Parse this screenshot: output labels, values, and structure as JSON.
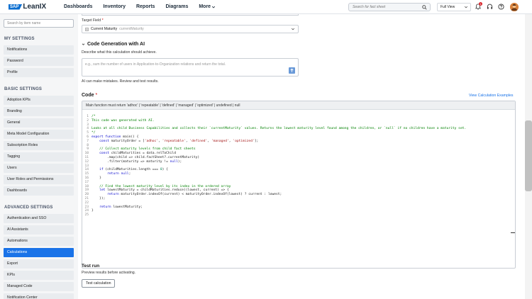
{
  "topbar": {
    "logo_sap": "SAP",
    "logo_name": "LeanIX",
    "nav": [
      "Dashboards",
      "Inventory",
      "Reports",
      "Diagrams",
      "More"
    ],
    "search_placeholder": "Search for fact sheet",
    "view_label": "Full View",
    "notification_count": "1",
    "icons": [
      "search-icon",
      "chevron-down-icon",
      "bell-icon",
      "headset-icon",
      "help-icon",
      "avatar"
    ]
  },
  "sidebar": {
    "search_placeholder": "Search by item name",
    "sections": [
      {
        "title": "MY SETTINGS",
        "items": [
          "Notifications",
          "Password",
          "Profile"
        ]
      },
      {
        "title": "BASIC SETTINGS",
        "items": [
          "Adoption KPIs",
          "Branding",
          "General",
          "Meta Model Configuration",
          "Subscription Roles",
          "Tagging",
          "Users",
          "User Roles and Permissions",
          "Dashboards"
        ]
      },
      {
        "title": "ADVANCED SETTINGS",
        "items": [
          "Authentication and SSO",
          "AI Assistants",
          "Automations",
          "Calculations",
          "Export",
          "KPIs",
          "Managed Code",
          "Notification Center"
        ]
      }
    ],
    "active_item": "Calculations"
  },
  "main": {
    "target_field_label": "Target Field",
    "target_field_required": "*",
    "target_field_value": "Current Maturity",
    "target_field_key": "currentMaturity",
    "codegen_title": "Code Generation with AI",
    "codegen_desc": "Describe what this calculation should achieve.",
    "codegen_placeholder": "e.g., sum the number of users in Application-to-Organization relations and return the total.",
    "ai_warning": "AI can make mistakes. Review and test results.",
    "code_label": "Code",
    "code_required": "*",
    "view_examples": "View Calculation Examples",
    "code_header": "Main function must return 'adhoc' | 'repeatable' | 'defined' | 'managed' | 'optimized' | undefined | null",
    "code_lines": [
      {
        "n": "1",
        "parts": [
          {
            "t": "/*",
            "c": "c-com"
          }
        ]
      },
      {
        "n": "2",
        "parts": [
          {
            "t": "This code was generated with AI.",
            "c": "c-com"
          }
        ]
      },
      {
        "n": "3",
        "parts": []
      },
      {
        "n": "4",
        "parts": [
          {
            "t": "Looks at all child Business Capabilities and collects their `currentMaturity` values. Returns the lowest maturity level found among the children, or `null` if no children have a maturity set.",
            "c": "c-com"
          }
        ]
      },
      {
        "n": "5",
        "parts": [
          {
            "t": "*/",
            "c": "c-com"
          }
        ]
      },
      {
        "n": "6",
        "parts": [
          {
            "t": "export function ",
            "c": "c-kw"
          },
          {
            "t": "main() {",
            "c": "c-txt"
          }
        ]
      },
      {
        "n": "7",
        "parts": [
          {
            "t": "    ",
            "c": "c-txt"
          },
          {
            "t": "const ",
            "c": "c-kw"
          },
          {
            "t": "maturityOrder = [",
            "c": "c-txt"
          },
          {
            "t": "'adhoc'",
            "c": "c-str"
          },
          {
            "t": ", ",
            "c": "c-txt"
          },
          {
            "t": "'repeatable'",
            "c": "c-str"
          },
          {
            "t": ", ",
            "c": "c-txt"
          },
          {
            "t": "'defined'",
            "c": "c-str"
          },
          {
            "t": ", ",
            "c": "c-txt"
          },
          {
            "t": "'managed'",
            "c": "c-str"
          },
          {
            "t": ", ",
            "c": "c-txt"
          },
          {
            "t": "'optimized'",
            "c": "c-str"
          },
          {
            "t": "];",
            "c": "c-txt"
          }
        ]
      },
      {
        "n": "8",
        "parts": []
      },
      {
        "n": "9",
        "parts": [
          {
            "t": "    // Collect maturity levels from child fact sheets",
            "c": "c-com"
          }
        ]
      },
      {
        "n": "10",
        "parts": [
          {
            "t": "    ",
            "c": "c-txt"
          },
          {
            "t": "const ",
            "c": "c-kw"
          },
          {
            "t": "childMaturities = data.relToChild",
            "c": "c-txt"
          }
        ]
      },
      {
        "n": "11",
        "parts": [
          {
            "t": "        .map(child => child.factSheet?.currentMaturity)",
            "c": "c-txt"
          }
        ]
      },
      {
        "n": "12",
        "parts": [
          {
            "t": "        .filter(maturity => maturity != ",
            "c": "c-txt"
          },
          {
            "t": "null",
            "c": "c-kw"
          },
          {
            "t": ");",
            "c": "c-txt"
          }
        ]
      },
      {
        "n": "13",
        "parts": []
      },
      {
        "n": "14",
        "parts": [
          {
            "t": "    ",
            "c": "c-txt"
          },
          {
            "t": "if ",
            "c": "c-kw"
          },
          {
            "t": "(childMaturities.length === ",
            "c": "c-txt"
          },
          {
            "t": "0",
            "c": "c-num"
          },
          {
            "t": ") {",
            "c": "c-txt"
          }
        ]
      },
      {
        "n": "15",
        "parts": [
          {
            "t": "        ",
            "c": "c-txt"
          },
          {
            "t": "return null",
            "c": "c-kw"
          },
          {
            "t": ";",
            "c": "c-txt"
          }
        ]
      },
      {
        "n": "16",
        "parts": [
          {
            "t": "    }",
            "c": "c-txt"
          }
        ]
      },
      {
        "n": "17",
        "parts": []
      },
      {
        "n": "18",
        "parts": [
          {
            "t": "    // Find the lowest maturity level by its index in the ordered array",
            "c": "c-com"
          }
        ]
      },
      {
        "n": "19",
        "parts": [
          {
            "t": "    ",
            "c": "c-txt"
          },
          {
            "t": "let ",
            "c": "c-kw"
          },
          {
            "t": "lowestMaturity = childMaturities.reduce((lowest, current) => {",
            "c": "c-txt"
          }
        ]
      },
      {
        "n": "20",
        "parts": [
          {
            "t": "        ",
            "c": "c-txt"
          },
          {
            "t": "return ",
            "c": "c-kw"
          },
          {
            "t": "maturityOrder.indexOf(current) < maturityOrder.indexOf(lowest) ? current : lowest;",
            "c": "c-txt"
          }
        ]
      },
      {
        "n": "21",
        "parts": [
          {
            "t": "    });",
            "c": "c-txt"
          }
        ]
      },
      {
        "n": "22",
        "parts": []
      },
      {
        "n": "23",
        "parts": [
          {
            "t": "    ",
            "c": "c-txt"
          },
          {
            "t": "return ",
            "c": "c-kw"
          },
          {
            "t": "lowestMaturity;",
            "c": "c-txt"
          }
        ]
      },
      {
        "n": "24",
        "parts": [
          {
            "t": "}",
            "c": "c-txt"
          }
        ]
      },
      {
        "n": "25",
        "parts": []
      }
    ],
    "test_title": "Test run",
    "test_desc": "Preview results before activating.",
    "test_button": "Test calculation"
  }
}
